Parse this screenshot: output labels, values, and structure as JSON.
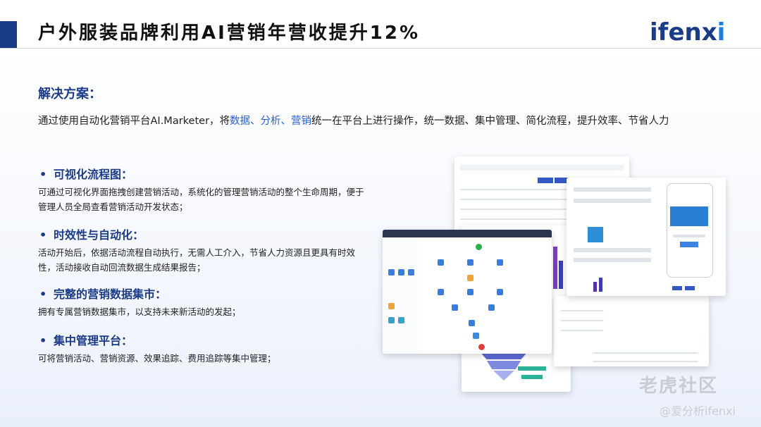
{
  "header": {
    "title": "户外服装品牌利用AI营销年营收提升12%",
    "logo_main": "ifenx",
    "logo_tail": "i"
  },
  "solution": {
    "heading": "解决方案：",
    "text_prefix": "通过使用自动化营销平台AI.Marketer，将",
    "hl1": "数据",
    "sep1": "、",
    "hl2": "分析",
    "sep2": "、",
    "hl3": "营销",
    "text_suffix": "统一在平台上进行操作，统一数据、集中管理、简化流程，提升效率、节省人力"
  },
  "features": [
    {
      "bullet": "•",
      "title": "可视化流程图：",
      "desc": "可通过可视化界面拖拽创建营销活动，系统化的管理营销活动的整个生命周期，便于管理人员全局查看营销活动开发状态；"
    },
    {
      "bullet": "•",
      "title": "时效性与自动化：",
      "desc": "活动开始后，依据活动流程自动执行，无需人工介入，节省人力资源且更具有时效性，活动接收自动回流数据生成结果报告；"
    },
    {
      "bullet": "•",
      "title": "完整的营销数据集市：",
      "desc": "拥有专属营销数据集市，以支持未来新活动的发起；"
    },
    {
      "bullet": "•",
      "title": "集中管理平台：",
      "desc": "可将营销活动、营销资源、效果追踪、费用追踪等集中管理；"
    }
  ],
  "watermark": {
    "line1": "老虎社区",
    "line2": "@爱分析ifenxi"
  },
  "colors": {
    "brand": "#1a3b86",
    "highlight": "#2c5fd6"
  }
}
